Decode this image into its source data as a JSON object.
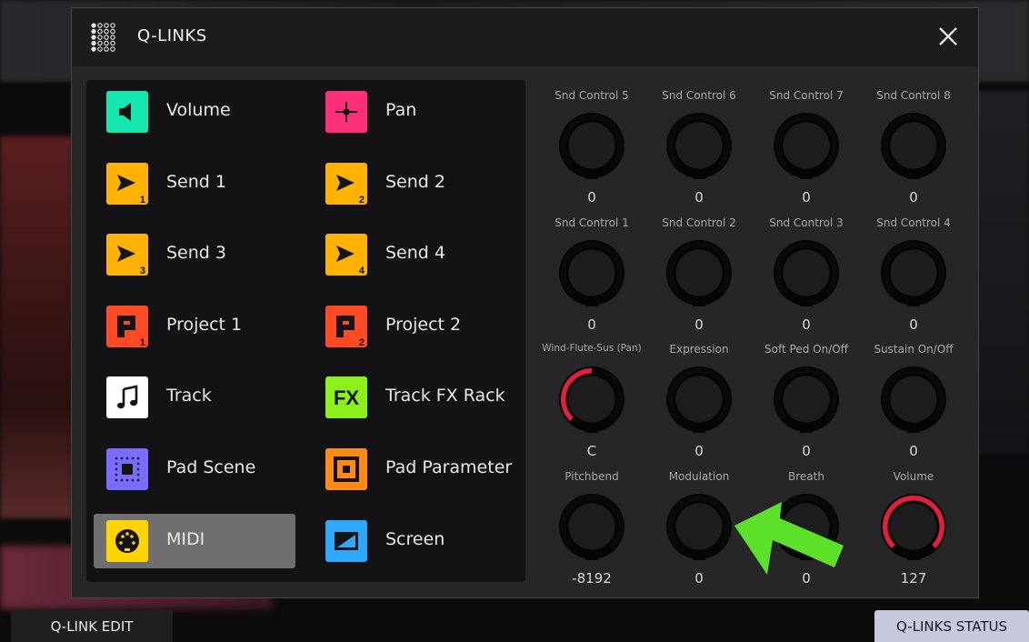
{
  "dialog": {
    "title": "Q-LINKS"
  },
  "list": [
    {
      "label": "Volume",
      "icon": "speaker-icon",
      "color": "#14e6b0",
      "sub": ""
    },
    {
      "label": "Pan",
      "icon": "pan-icon",
      "color": "#ff2e7a",
      "sub": ""
    },
    {
      "label": "Send 1",
      "icon": "send-icon",
      "color": "#ffb300",
      "sub": "1"
    },
    {
      "label": "Send 2",
      "icon": "send-icon",
      "color": "#ffb300",
      "sub": "2"
    },
    {
      "label": "Send 3",
      "icon": "send-icon",
      "color": "#ffb300",
      "sub": "3"
    },
    {
      "label": "Send 4",
      "icon": "send-icon",
      "color": "#ffb300",
      "sub": "4"
    },
    {
      "label": "Project 1",
      "icon": "project-icon",
      "color": "#ff4a24",
      "sub": "1"
    },
    {
      "label": "Project 2",
      "icon": "project-icon",
      "color": "#ff4a24",
      "sub": "2"
    },
    {
      "label": "Track",
      "icon": "music-note-icon",
      "color": "#ffffff",
      "sub": ""
    },
    {
      "label": "Track FX Rack",
      "icon": "fx-icon",
      "color": "#8cf01a",
      "sub": ""
    },
    {
      "label": "Pad Scene",
      "icon": "pad-scene-icon",
      "color": "#7a6cff",
      "sub": ""
    },
    {
      "label": "Pad Parameter",
      "icon": "pad-parameter-icon",
      "color": "#ff8a14",
      "sub": ""
    },
    {
      "label": "MIDI",
      "icon": "midi-icon",
      "color": "#ffd400",
      "sub": "",
      "selected": true
    },
    {
      "label": "Screen",
      "icon": "screen-icon",
      "color": "#2ea8ff",
      "sub": ""
    }
  ],
  "knobs": [
    {
      "label": "Snd Control 5",
      "value": "0",
      "level": 0
    },
    {
      "label": "Snd Control 6",
      "value": "0",
      "level": 0
    },
    {
      "label": "Snd Control 7",
      "value": "0",
      "level": 0
    },
    {
      "label": "Snd Control 8",
      "value": "0",
      "level": 0
    },
    {
      "label": "Snd Control 1",
      "value": "0",
      "level": 0
    },
    {
      "label": "Snd Control 2",
      "value": "0",
      "level": 0
    },
    {
      "label": "Snd Control 3",
      "value": "0",
      "level": 0
    },
    {
      "label": "Snd Control 4",
      "value": "0",
      "level": 0
    },
    {
      "label": "Wind-Flute-Sus (Pan)",
      "value": "C",
      "level": 0.5
    },
    {
      "label": "Expression",
      "value": "0",
      "level": 0
    },
    {
      "label": "Soft Ped On/Off",
      "value": "0",
      "level": 0
    },
    {
      "label": "Sustain On/Off",
      "value": "0",
      "level": 0
    },
    {
      "label": "Pitchbend",
      "value": "-8192",
      "level": 0
    },
    {
      "label": "Modulation",
      "value": "0",
      "level": 0
    },
    {
      "label": "Breath",
      "value": "0",
      "level": 0
    },
    {
      "label": "Volume",
      "value": "127",
      "level": 1
    }
  ],
  "colors": {
    "knob_active": "#e0203c",
    "arrow": "#5ce02a"
  },
  "bottom": {
    "left_tab": "Q-LINK EDIT",
    "right_tab": "Q-LINKS STATUS"
  }
}
